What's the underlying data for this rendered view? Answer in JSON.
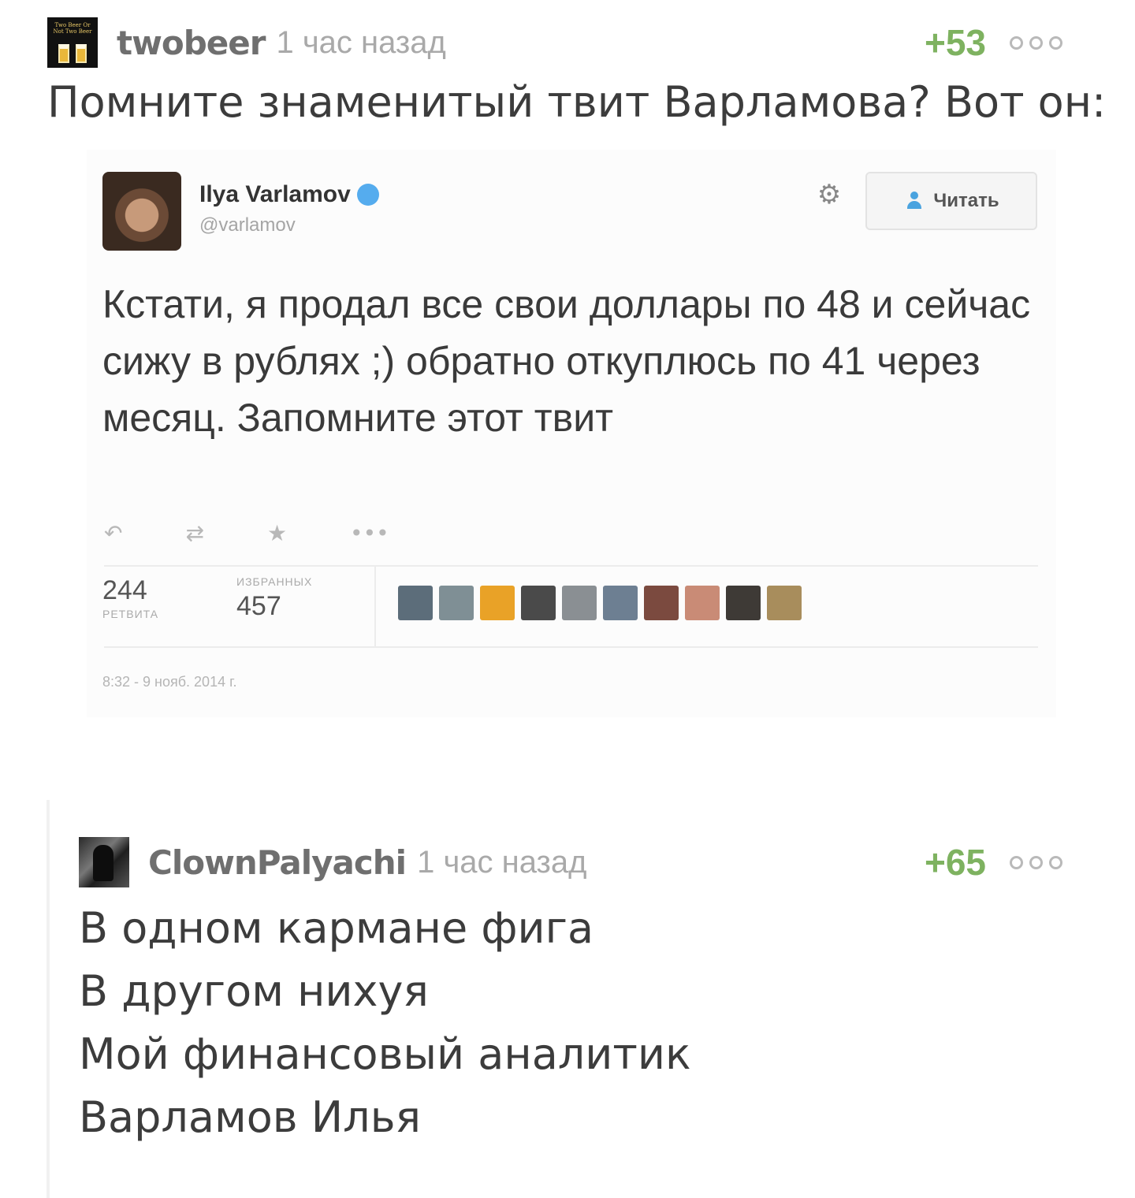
{
  "comments": [
    {
      "username": "twobeer",
      "time": "1 час назад",
      "rating": "+53",
      "avatar_icon": "beer-glasses-icon",
      "avatar_text": "Two Beer Or Not Two Beer",
      "text": "Помните знаменитый твит Варламова? Вот он:",
      "tweet": {
        "author_name": "Ilya Varlamov",
        "handle": "@varlamov",
        "follow_label": "Читать",
        "text": "Кстати, я продал все свои доллары по 48 и сейчас сижу в рублях ;) обратно откуплюсь по 41 через месяц. Запомните этот твит",
        "retweets_count": "244",
        "retweets_label": "РЕТВИТА",
        "favorites_count": "457",
        "favorites_label": "ИЗБРАННЫХ",
        "date": "8:32 - 9 нояб. 2014 г.",
        "actions": [
          "reply-icon",
          "retweet-icon",
          "favorite-icon",
          "more-icon"
        ],
        "face_colors": [
          "#5c6d7a",
          "#7f8f95",
          "#e9a227",
          "#4a4a4a",
          "#8a8f93",
          "#6d7f92",
          "#7b4a3f",
          "#c98b76",
          "#3e3a36",
          "#a88d5c"
        ]
      }
    },
    {
      "username": "ClownPalyachi",
      "time": "1 час назад",
      "rating": "+65",
      "avatar_icon": "noir-figure-avatar",
      "lines": [
        "В одном кармане фига",
        "В другом нихуя",
        "Мой финансовый аналитик",
        "Варламов Илья"
      ]
    }
  ],
  "colors": {
    "rating_green": "#7eb260",
    "username_gray": "#6f6f6f",
    "time_gray": "#a9a9a9",
    "text": "#3c3c3c",
    "twitter_blue": "#55acee"
  }
}
